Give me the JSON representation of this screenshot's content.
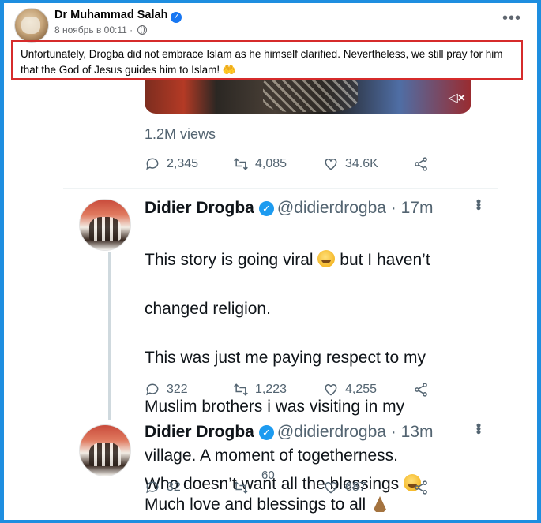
{
  "facebook_post": {
    "author": "Dr Muhammad Salah",
    "timestamp": "8 ноябрь в 00:11",
    "caption": "Unfortunately, Drogba did not embrace Islam as he himself clarified. Nevertheless, we still pray for him that the God of Jesus guides him to Islam! 🤲",
    "more_icon": "more-dots-icon"
  },
  "embedded_video": {
    "views": "1.2M views",
    "stats": {
      "replies": "2,345",
      "retweets": "4,085",
      "likes": "34.6K"
    }
  },
  "tweets": [
    {
      "name": "Didier Drogba",
      "handle": "@didierdrogba",
      "time": "· 17m",
      "text_lines": [
        "This story is going viral",
        "but I haven’t",
        "changed religion.",
        "This was just me paying respect to my",
        "Muslim brothers i was visiting in my",
        "village. A moment of togetherness.",
        "Much love and blessings to all"
      ],
      "stats": {
        "replies": "322",
        "retweets": "1,223",
        "likes": "4,255"
      }
    },
    {
      "name": "Didier Drogba",
      "handle": "@didierdrogba",
      "time": "· 13m",
      "text_lines": [
        "Who doesn’t want all the blessings"
      ],
      "stats": {
        "replies": "32",
        "retweets": "60",
        "likes": "687"
      }
    }
  ],
  "colors": {
    "facebook_blue": "#1877f2",
    "twitter_blue": "#1d9bf0",
    "highlight_red": "#d62b2b",
    "frame_blue": "#1e8ee0"
  }
}
